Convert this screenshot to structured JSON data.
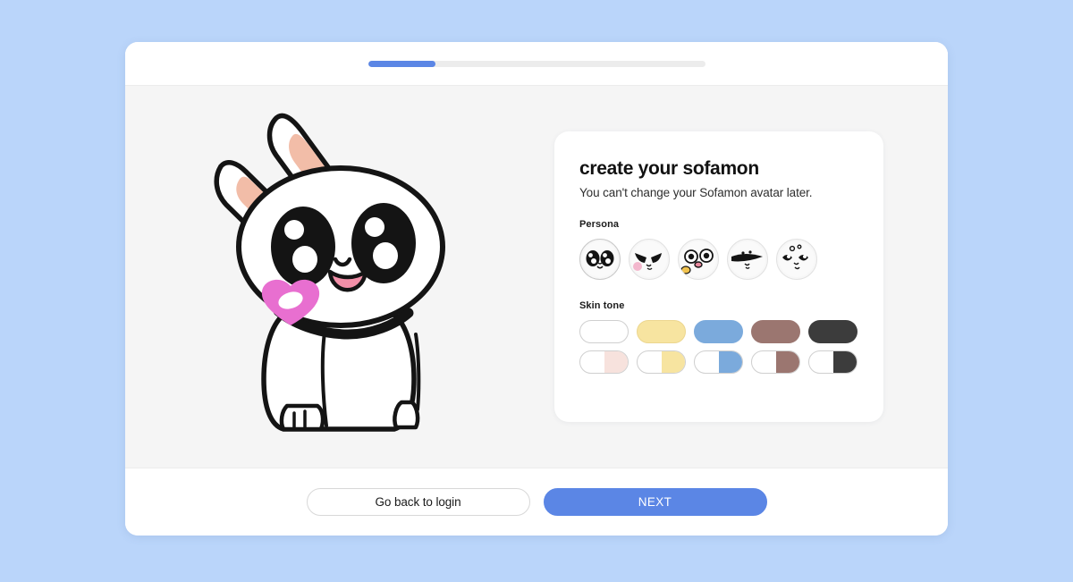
{
  "header": {
    "progress_percent": 20
  },
  "avatar": {
    "alt_name": "white rabbit sofamon avatar",
    "body_color": "#ffffff",
    "outline_color": "#141414",
    "ear_inner_color": "#f2bda8",
    "blush_color": "#e86fd0",
    "mouth_color": "#f28fa8"
  },
  "card": {
    "title": "create your sofamon",
    "subtitle": "You can't change your Sofamon avatar later.",
    "persona": {
      "label": "Persona",
      "selected_index": 0,
      "options": [
        {
          "name": "persona-panda-eyes",
          "selected": true
        },
        {
          "name": "persona-cool-shades",
          "selected": false
        },
        {
          "name": "persona-wide-eyes",
          "selected": false
        },
        {
          "name": "persona-bandit-mask",
          "selected": false
        },
        {
          "name": "persona-sparkle-eyes",
          "selected": false
        }
      ]
    },
    "skin_tone": {
      "label": "Skin tone",
      "row1": [
        {
          "name": "tone-white",
          "color": "#ffffff",
          "selected": true
        },
        {
          "name": "tone-yellow",
          "color": "#f7e4a0",
          "selected": false
        },
        {
          "name": "tone-blue",
          "color": "#7baadc",
          "selected": false
        },
        {
          "name": "tone-brown",
          "color": "#9b7670",
          "selected": false
        },
        {
          "name": "tone-dark",
          "color": "#3c3c3c",
          "selected": false
        }
      ],
      "row2": [
        {
          "name": "tone-half-pink",
          "color": "#f7e2dd",
          "selected": false
        },
        {
          "name": "tone-half-yellow",
          "color": "#f7e4a0",
          "selected": false
        },
        {
          "name": "tone-half-blue",
          "color": "#7baadc",
          "selected": false
        },
        {
          "name": "tone-half-brown",
          "color": "#9b7670",
          "selected": false
        },
        {
          "name": "tone-half-dark",
          "color": "#3c3c3c",
          "selected": false
        }
      ]
    }
  },
  "footer": {
    "back_label": "Go back to login",
    "next_label": "NEXT"
  },
  "colors": {
    "page_background": "#bad5fa",
    "accent": "#5b86e5",
    "body_background": "#f5f5f5"
  }
}
